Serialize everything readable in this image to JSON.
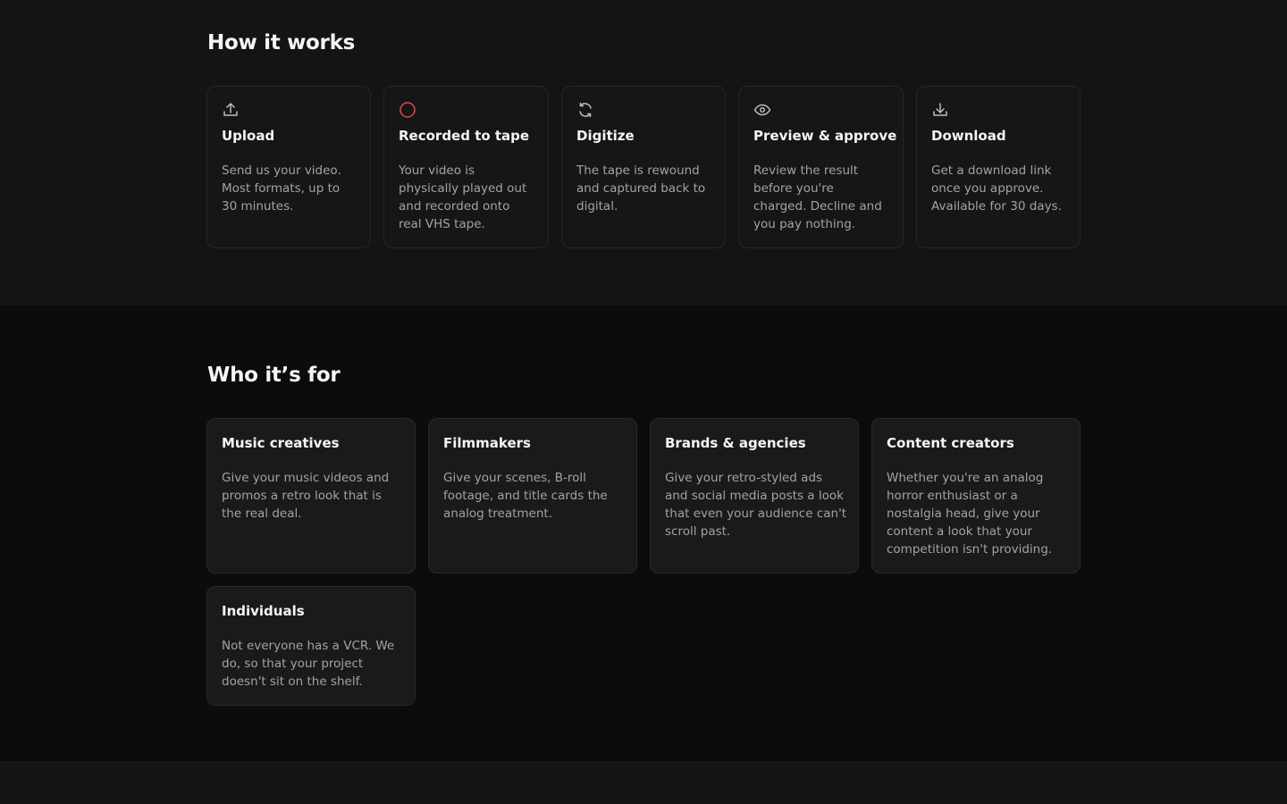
{
  "how": {
    "title": "How it works",
    "steps": [
      {
        "icon": "upload-icon",
        "title": "Upload",
        "desc": "Send us your video. Most formats, up to 30 minutes."
      },
      {
        "icon": "record-circle-icon",
        "title": "Recorded to tape",
        "desc": "Your video is physically played out and recorded onto real VHS tape."
      },
      {
        "icon": "refresh-icon",
        "title": "Digitize",
        "desc": "The tape is rewound and captured back to digital."
      },
      {
        "icon": "eye-icon",
        "title": "Preview & approve",
        "desc": "Review the result before you're charged. Decline and you pay nothing."
      },
      {
        "icon": "download-icon",
        "title": "Download",
        "desc": "Get a download link once you approve. Available for 30 days."
      }
    ]
  },
  "who": {
    "title": "Who it’s for",
    "audiences": [
      {
        "title": "Music creatives",
        "desc": "Give your music videos and promos a retro look that is the real deal."
      },
      {
        "title": "Filmmakers",
        "desc": "Give your scenes, B-roll footage, and title cards the analog treatment."
      },
      {
        "title": "Brands & agencies",
        "desc": "Give your retro-styled ads and social media posts a look that even your audience can't scroll past."
      },
      {
        "title": "Content creators",
        "desc": "Whether you're an analog horror enthusiast or a nostalgia head, give your content a look that your competition isn't providing."
      },
      {
        "title": "Individuals",
        "desc": "Not everyone has a VCR. We do, so that your project doesn't sit on the shelf."
      }
    ]
  },
  "colors": {
    "accent_red": "#e5484d",
    "icon_gray": "#bdbdbd"
  }
}
